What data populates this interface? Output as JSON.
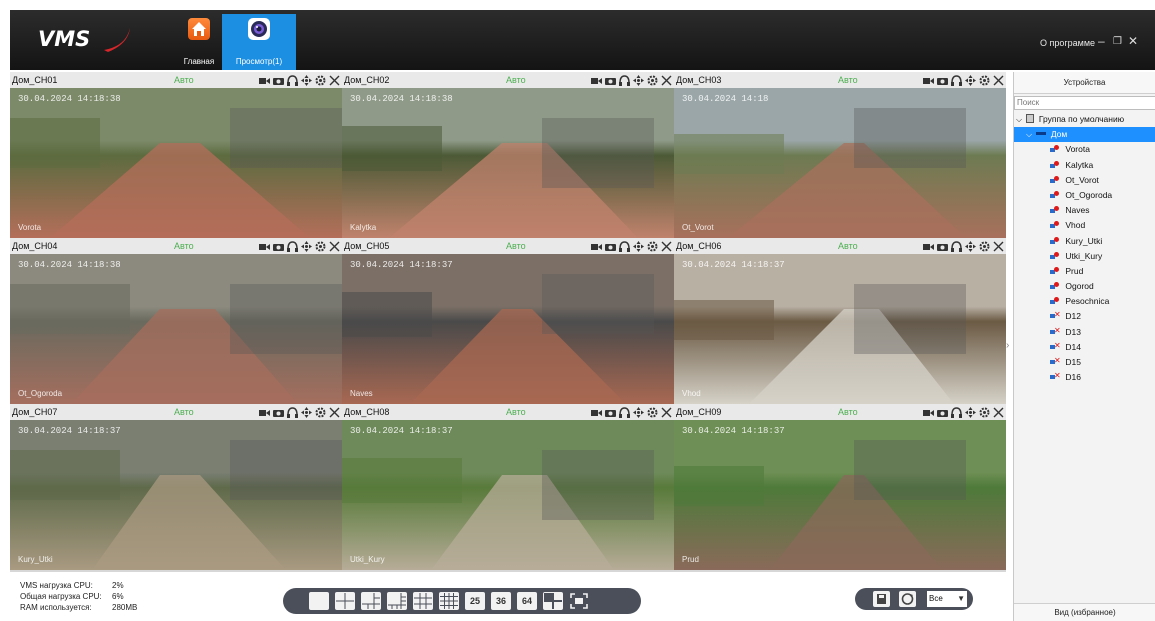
{
  "app": {
    "logo_text": "VMS",
    "nav": [
      {
        "label": "Главная",
        "icon": "home-icon"
      },
      {
        "label": "Просмотр(1)",
        "icon": "camera-lens-icon"
      }
    ],
    "about_label": "О программе",
    "window_controls": [
      "minimize-icon",
      "restore-icon",
      "close-icon"
    ]
  },
  "mode_label": "Авто",
  "cells": [
    {
      "name": "Дом_CH01",
      "stamp": "30.04.2024 14:18:38",
      "caption": "Vorota"
    },
    {
      "name": "Дом_CH02",
      "stamp": "30.04.2024 14:18:38",
      "caption": "Kalytka"
    },
    {
      "name": "Дом_CH03",
      "stamp": "30.04.2024 14:18",
      "caption": "Ot_Vorot"
    },
    {
      "name": "Дом_CH04",
      "stamp": "30.04.2024 14:18:38",
      "caption": "Ot_Ogoroda"
    },
    {
      "name": "Дом_CH05",
      "stamp": "30.04.2024 14:18:37",
      "caption": "Naves"
    },
    {
      "name": "Дом_CH06",
      "stamp": "30.04.2024 14:18:37",
      "caption": "Vhod"
    },
    {
      "name": "Дом_CH07",
      "stamp": "30.04.2024 14:18:37",
      "caption": "Kury_Utki"
    },
    {
      "name": "Дом_CH08",
      "stamp": "30.04.2024 14:18:37",
      "caption": "Utki_Kury"
    },
    {
      "name": "Дом_CH09",
      "stamp": "30.04.2024 14:18:37",
      "caption": "Prud"
    }
  ],
  "side": {
    "header": "Устройства",
    "search_placeholder": "Поиск",
    "group": "Группа по умолчанию",
    "device": "Дом",
    "cameras_online": [
      "Vorota",
      "Kalytka",
      "Ot_Vorot",
      "Ot_Ogoroda",
      "Naves",
      "Vhod",
      "Kury_Utki",
      "Utki_Kury",
      "Prud",
      "Ogorod",
      "Pesochnica"
    ],
    "cameras_offline": [
      "D12",
      "D13",
      "D14",
      "D15",
      "D16"
    ],
    "footer": "Вид (избранное)"
  },
  "stats": [
    {
      "label": "VMS нагрузка CPU:",
      "value": "2%"
    },
    {
      "label": "Общая нагрузка CPU:",
      "value": "6%"
    },
    {
      "label": "RAM используется:",
      "value": "280MB"
    }
  ],
  "layout_buttons": [
    "1x1",
    "2x2",
    "1+5",
    "1+7",
    "3x3",
    "4x4",
    "25",
    "36",
    "64",
    "custom",
    "fullscreen"
  ],
  "stream_select": "Все"
}
